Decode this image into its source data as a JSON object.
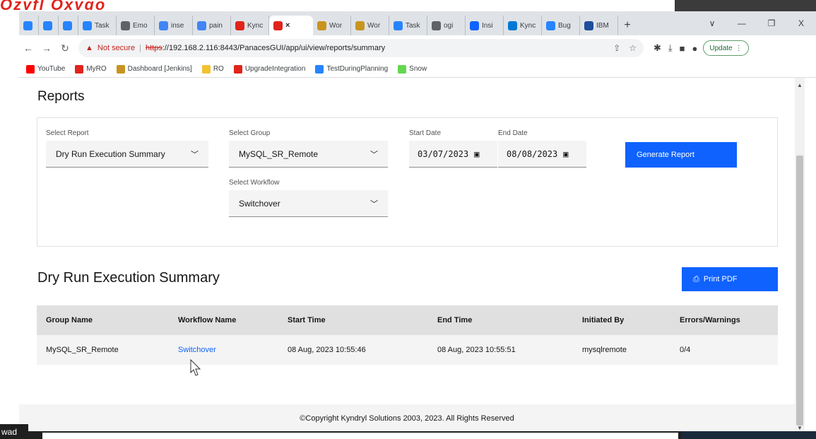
{
  "top_strip": {
    "partial_text": "Ozyfl Oxygo"
  },
  "browser": {
    "tabs": [
      {
        "label": "",
        "icon": "jira-icon",
        "color": "#2684ff"
      },
      {
        "label": "",
        "icon": "jira-icon",
        "color": "#2684ff"
      },
      {
        "label": "",
        "icon": "jira-icon",
        "color": "#2684ff"
      },
      {
        "label": "Task",
        "icon": "jira-icon",
        "color": "#2684ff"
      },
      {
        "label": "Emo",
        "icon": "globe-icon",
        "color": "#5f6368"
      },
      {
        "label": "inse",
        "icon": "google-icon",
        "color": "#4285f4"
      },
      {
        "label": "pain",
        "icon": "google-icon",
        "color": "#4285f4"
      },
      {
        "label": "Kync",
        "icon": "kyndryl-icon",
        "color": "#e0241b"
      },
      {
        "label": "",
        "icon": "kyndryl-icon",
        "color": "#e0241b",
        "active": true
      },
      {
        "label": "Wor",
        "icon": "jenkins-icon",
        "color": "#c8941f"
      },
      {
        "label": "Wor",
        "icon": "jenkins-icon",
        "color": "#c8941f"
      },
      {
        "label": "Task",
        "icon": "jira-icon",
        "color": "#2684ff"
      },
      {
        "label": "ogi",
        "icon": "globe-icon",
        "color": "#5f6368"
      },
      {
        "label": "Insi",
        "icon": "cloud-icon",
        "color": "#0f62fe"
      },
      {
        "label": "Kync",
        "icon": "outlook-icon",
        "color": "#0078d4"
      },
      {
        "label": "Bug",
        "icon": "jira-icon",
        "color": "#2684ff"
      },
      {
        "label": "IBM",
        "icon": "ibm-icon",
        "color": "#1f4e9c"
      }
    ],
    "new_tab": "+",
    "window_controls": [
      "∨",
      "—",
      "❐",
      "X"
    ],
    "address": {
      "warning": "▲",
      "not_secure": "Not secure",
      "scheme": "https",
      "url_rest": "://192.168.2.116:8443/PanacesGUI/app/ui/view/reports/summary"
    },
    "update_label": "Update",
    "bookmarks": [
      {
        "label": "YouTube",
        "icon": "youtube-icon",
        "color": "#ff0000"
      },
      {
        "label": "MyRO",
        "icon": "kyndryl-icon",
        "color": "#e0241b"
      },
      {
        "label": "Dashboard [Jenkins]",
        "icon": "jenkins-icon",
        "color": "#c8941f"
      },
      {
        "label": "RO",
        "icon": "folder-icon",
        "color": "#f2c230"
      },
      {
        "label": "UpgradeIntegration",
        "icon": "kyndryl-icon",
        "color": "#e0241b"
      },
      {
        "label": "TestDuringPlanning",
        "icon": "jira-icon",
        "color": "#2684ff"
      },
      {
        "label": "Snow",
        "icon": "servicenow-icon",
        "color": "#62d84e"
      }
    ]
  },
  "reports": {
    "title": "Reports",
    "select_report_label": "Select Report",
    "select_report_value": "Dry Run Execution Summary",
    "select_group_label": "Select Group",
    "select_group_value": "MySQL_SR_Remote",
    "select_workflow_label": "Select Workflow",
    "select_workflow_value": "Switchover",
    "start_date_label": "Start Date",
    "start_date_value": "03/07/2023",
    "end_date_label": "End Date",
    "end_date_value": "08/08/2023",
    "generate_button": "Generate Report"
  },
  "summary": {
    "title": "Dry Run Execution Summary",
    "print_button": "Print PDF",
    "columns": [
      "Group Name",
      "Workflow Name",
      "Start Time",
      "End Time",
      "Initiated By",
      "Errors/Warnings"
    ],
    "rows": [
      {
        "group_name": "MySQL_SR_Remote",
        "workflow_name": "Switchover",
        "start_time": "08 Aug, 2023 10:55:46",
        "end_time": "08 Aug, 2023 10:55:51",
        "initiated_by": "mysqlremote",
        "errors_warnings": "0/4"
      }
    ]
  },
  "footer": {
    "copyright": "©Copyright Kyndryl Solutions 2003, 2023. All Rights Reserved"
  },
  "taskbar": {
    "left_text": "wad"
  },
  "colors": {
    "primary": "#0f62fe",
    "table_header": "#e0e0e0",
    "row_bg": "#f4f4f4",
    "brand_red": "#e0241b"
  }
}
